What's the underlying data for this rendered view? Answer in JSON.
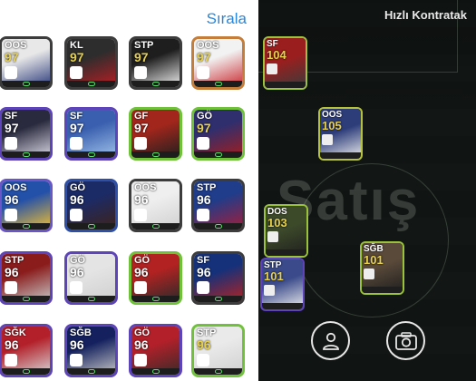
{
  "header": {
    "sort_label": "Sırala",
    "quick_contract_label": "Hızlı Kontratak"
  },
  "colors": {
    "accent_blue": "#2a86d9",
    "rating_yellow": "#e7d04c",
    "rating_white": "#ffffff",
    "skill_green": "#58e06a"
  },
  "watermark": {
    "text": "Satış"
  },
  "players": [
    {
      "pos": "OOS",
      "rating": "97",
      "frame": "#3c3c3c",
      "rating_color": "#e7d04c",
      "bg": [
        "#e8e8e8",
        "#2b3a7a"
      ]
    },
    {
      "pos": "KL",
      "rating": "97",
      "frame": "#3c3c3c",
      "rating_color": "#e7d04c",
      "bg": [
        "#2d2d2d",
        "#b81e24"
      ]
    },
    {
      "pos": "STP",
      "rating": "97",
      "frame": "#3c3c3c",
      "rating_color": "#e7d04c",
      "bg": [
        "#1e1e1e",
        "#f0f0f0"
      ]
    },
    {
      "pos": "OOS",
      "rating": "97",
      "frame": "#c47e3a",
      "rating_color": "#e7d04c",
      "bg": [
        "#f2f2f2",
        "#c92a30"
      ]
    },
    {
      "pos": "SF",
      "rating": "97",
      "frame": "#5d44b8",
      "rating_color": "#ffffff",
      "bg": [
        "#2a2a3e",
        "#d9d9e6"
      ]
    },
    {
      "pos": "SF",
      "rating": "97",
      "frame": "#5d44b8",
      "rating_color": "#ffffff",
      "bg": [
        "#3a5fae",
        "#9fc2ea"
      ]
    },
    {
      "pos": "GF",
      "rating": "97",
      "frame": "#6fc23a",
      "rating_color": "#ffffff",
      "bg": [
        "#a3261c",
        "#1f1f1f"
      ]
    },
    {
      "pos": "GÖ",
      "rating": "97",
      "frame": "#6fc23a",
      "rating_color": "#e7d04c",
      "bg": [
        "#2f2f6e",
        "#a31d1d"
      ]
    },
    {
      "pos": "OOS",
      "rating": "96",
      "frame": "#6b56c8",
      "rating_color": "#ffffff",
      "bg": [
        "#2350a8",
        "#f0c030"
      ]
    },
    {
      "pos": "GÖ",
      "rating": "96",
      "frame": "#2d4fa8",
      "rating_color": "#ffffff",
      "bg": [
        "#1b2b66",
        "#3f2218"
      ]
    },
    {
      "pos": "OOS",
      "rating": "96",
      "frame": "#3c3c3c",
      "rating_color": "#ffffff",
      "bg": [
        "#efefef",
        "#cfcfcf"
      ]
    },
    {
      "pos": "STP",
      "rating": "96",
      "frame": "#3c3c3c",
      "rating_color": "#ffffff",
      "bg": [
        "#1f3d8a",
        "#a31d39"
      ]
    },
    {
      "pos": "STP",
      "rating": "96",
      "frame": "#5d44b8",
      "rating_color": "#ffffff",
      "bg": [
        "#8a1c1c",
        "#c7c7c7"
      ]
    },
    {
      "pos": "GÖ",
      "rating": "96",
      "frame": "#5d44b8",
      "rating_color": "#ffffff",
      "bg": [
        "#e4e4e4",
        "#cfcfcf"
      ]
    },
    {
      "pos": "GÖ",
      "rating": "96",
      "frame": "#6fc23a",
      "rating_color": "#ffffff",
      "bg": [
        "#b22222",
        "#2a2a2a"
      ]
    },
    {
      "pos": "SF",
      "rating": "96",
      "frame": "#3c3c3c",
      "rating_color": "#ffffff",
      "bg": [
        "#15317a",
        "#b22222"
      ]
    },
    {
      "pos": "SĞK",
      "rating": "96",
      "frame": "#5d44b8",
      "rating_color": "#ffffff",
      "bg": [
        "#b3202a",
        "#d6d6d6"
      ]
    },
    {
      "pos": "SĞB",
      "rating": "96",
      "frame": "#5d44b8",
      "rating_color": "#ffffff",
      "bg": [
        "#14215e",
        "#c7c7c7"
      ]
    },
    {
      "pos": "GÖ",
      "rating": "96",
      "frame": "#5d44b8",
      "rating_color": "#ffffff",
      "bg": [
        "#b3202a",
        "#3a2a28"
      ]
    },
    {
      "pos": "STP",
      "rating": "96",
      "frame": "#6fc23a",
      "rating_color": "#e7d04c",
      "bg": [
        "#eaeaea",
        "#d0d0d0"
      ]
    }
  ],
  "field_players": [
    {
      "pos": "SF",
      "rating": "104",
      "frame": "#9ac23a",
      "bg": [
        "#9b1e1e",
        "#3b3b3b"
      ]
    },
    {
      "pos": "OOS",
      "rating": "105",
      "frame": "#b5c23a",
      "bg": [
        "#2d3d7a",
        "#efefef"
      ]
    },
    {
      "pos": "DOS",
      "rating": "103",
      "frame": "#9ac23a",
      "bg": [
        "#3d4a2a",
        "#1f1f1f"
      ]
    },
    {
      "pos": "STP",
      "rating": "101",
      "frame": "#5d44b8",
      "bg": [
        "#3a4a8a",
        "#efefef"
      ]
    },
    {
      "pos": "SĞB",
      "rating": "101",
      "frame": "#9ac23a",
      "bg": [
        "#5a4a3a",
        "#1e1e1e"
      ]
    }
  ],
  "icons": {
    "profile": "person-icon",
    "camera": "camera-icon"
  }
}
